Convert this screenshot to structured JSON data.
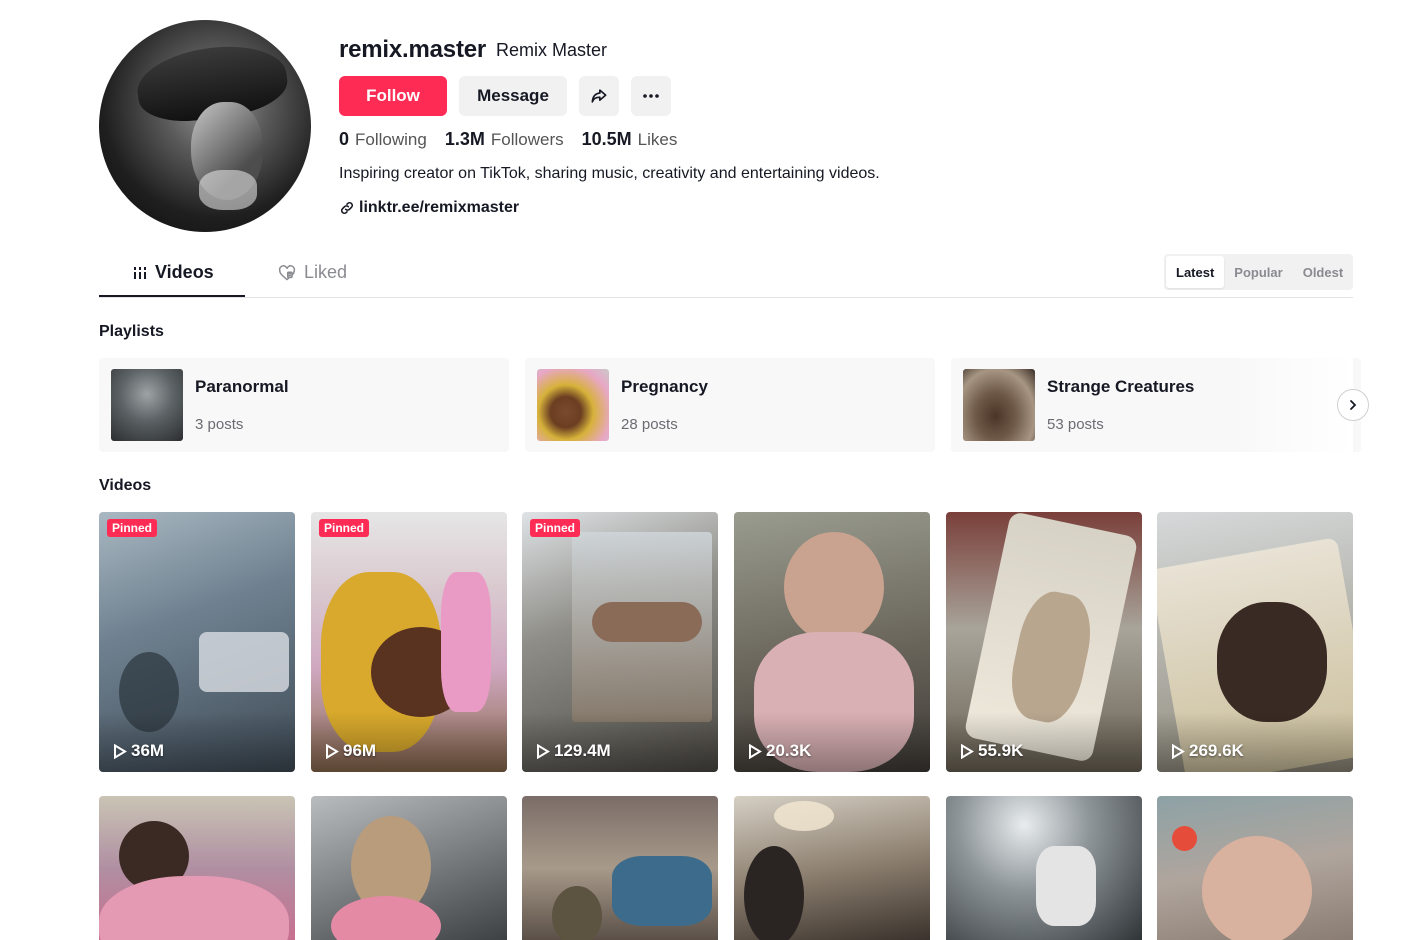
{
  "profile": {
    "username": "remix.master",
    "nickname": "Remix Master",
    "follow_label": "Follow",
    "message_label": "Message",
    "stats": {
      "following_count": "0",
      "following_label": "Following",
      "followers_count": "1.3M",
      "followers_label": "Followers",
      "likes_count": "10.5M",
      "likes_label": "Likes"
    },
    "bio": "Inspiring creator on TikTok, sharing music, creativity and entertaining videos.",
    "link": "linktr.ee/remixmaster"
  },
  "tabs": {
    "videos": "Videos",
    "liked": "Liked"
  },
  "sort": {
    "latest": "Latest",
    "popular": "Popular",
    "oldest": "Oldest",
    "active": "Latest"
  },
  "sections": {
    "playlists": "Playlists",
    "videos": "Videos"
  },
  "playlists": [
    {
      "name": "Paranormal",
      "count": "3 posts"
    },
    {
      "name": "Pregnancy",
      "count": "28 posts"
    },
    {
      "name": "Strange Creatures",
      "count": "53 posts"
    }
  ],
  "pinned_label": "Pinned",
  "videos": [
    {
      "views": "36M",
      "pinned": true
    },
    {
      "views": "96M",
      "pinned": true
    },
    {
      "views": "129.4M",
      "pinned": true
    },
    {
      "views": "20.3K",
      "pinned": false
    },
    {
      "views": "55.9K",
      "pinned": false
    },
    {
      "views": "269.6K",
      "pinned": false
    }
  ],
  "colors": {
    "accent": "#fe2c55",
    "text": "#161823",
    "muted": "#8a8b91",
    "surface": "#f1f1f2"
  },
  "icons": [
    "share-icon",
    "more-icon",
    "link-icon",
    "grid-icon",
    "heart-icon",
    "chevron-right-icon",
    "play-icon"
  ]
}
